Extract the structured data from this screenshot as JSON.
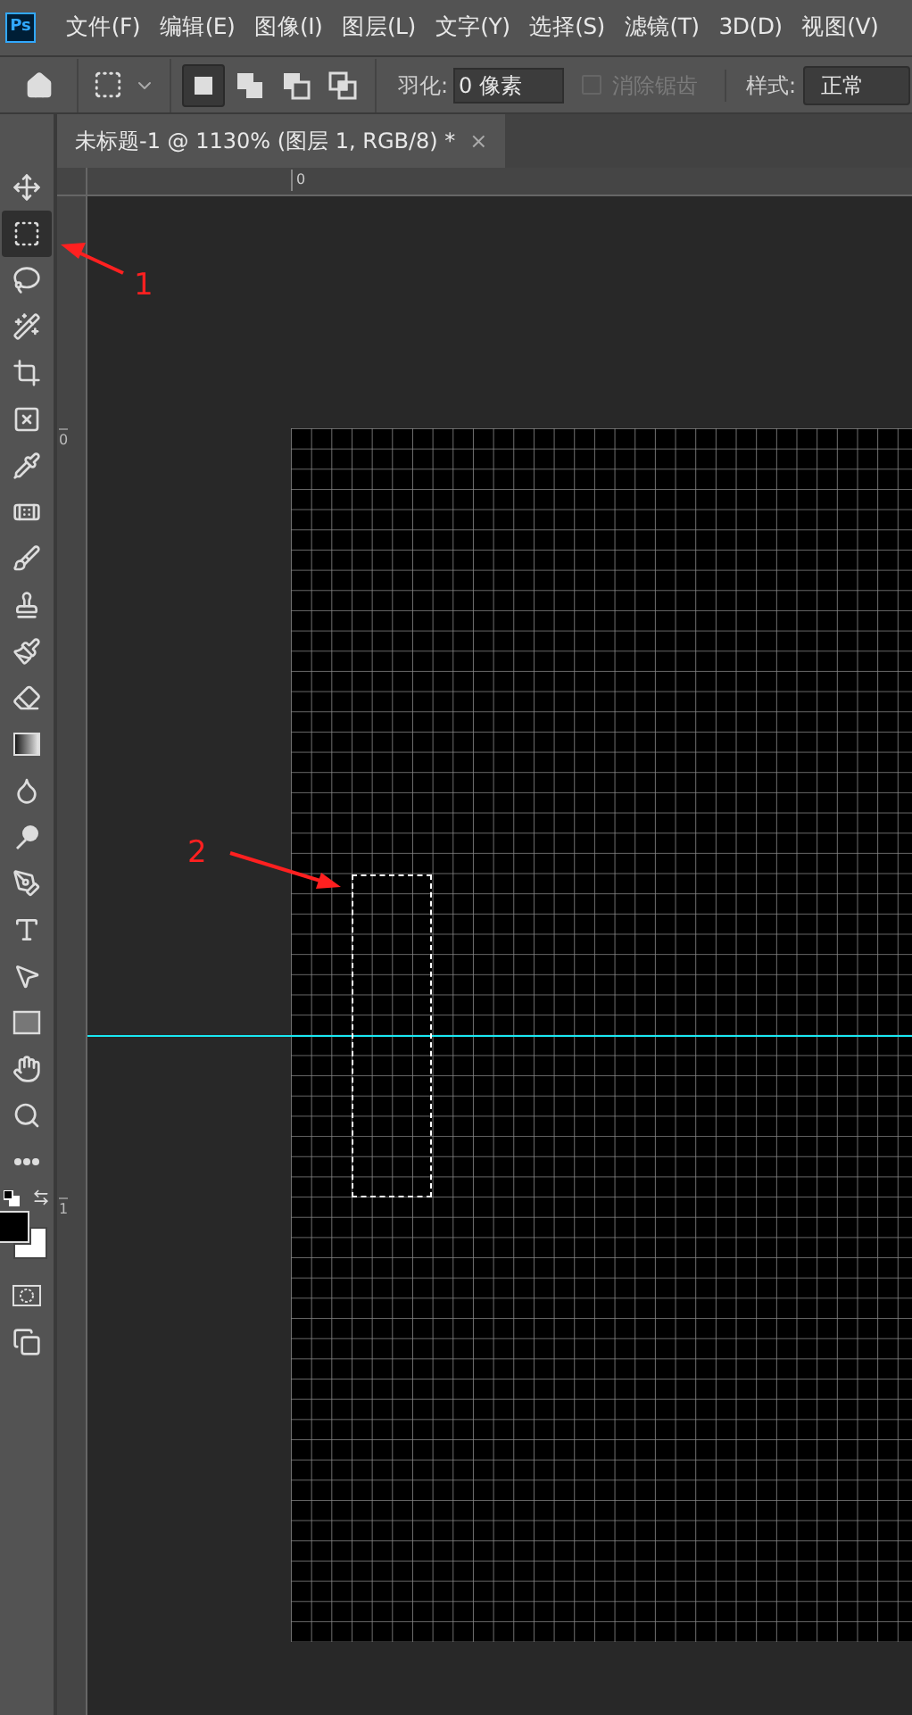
{
  "app_logo": "Ps",
  "menu": [
    "文件(F)",
    "编辑(E)",
    "图像(I)",
    "图层(L)",
    "文字(Y)",
    "选择(S)",
    "滤镜(T)",
    "3D(D)",
    "视图(V)"
  ],
  "options_bar": {
    "modes": [
      {
        "kind": "new",
        "selected": true
      },
      {
        "kind": "add",
        "selected": false
      },
      {
        "kind": "subtract",
        "selected": false
      },
      {
        "kind": "intersect",
        "selected": false
      }
    ],
    "feather_label": "羽化:",
    "feather_value": "0 像素",
    "antialias": {
      "label": "消除锯齿",
      "checked": false,
      "disabled": true
    },
    "style_label": "样式:",
    "style_value": "正常"
  },
  "document_tab": {
    "title": "未标题-1 @ 1130% (图层 1, RGB/8) *",
    "close": "×"
  },
  "rulers": {
    "horizontal": [
      "0"
    ],
    "vertical": [
      "0",
      "1"
    ]
  },
  "tools": [
    {
      "kind": "move",
      "selected": false
    },
    {
      "kind": "marquee",
      "selected": true
    },
    {
      "kind": "lasso",
      "selected": false
    },
    {
      "kind": "quick",
      "selected": false
    },
    {
      "kind": "crop",
      "selected": false
    },
    {
      "kind": "frame",
      "selected": false
    },
    {
      "kind": "eyedropper",
      "selected": false
    },
    {
      "kind": "heal",
      "selected": false
    },
    {
      "kind": "brush",
      "selected": false
    },
    {
      "kind": "stamp",
      "selected": false
    },
    {
      "kind": "history",
      "selected": false
    },
    {
      "kind": "eraser",
      "selected": false
    },
    {
      "kind": "gradient",
      "selected": false
    },
    {
      "kind": "blur",
      "selected": false
    },
    {
      "kind": "dodge",
      "selected": false
    },
    {
      "kind": "pen",
      "selected": false
    },
    {
      "kind": "type",
      "selected": false
    },
    {
      "kind": "path",
      "selected": false
    },
    {
      "kind": "rect",
      "selected": false
    },
    {
      "kind": "hand",
      "selected": false
    },
    {
      "kind": "zoom",
      "selected": false
    },
    {
      "kind": "more",
      "selected": false
    }
  ],
  "swatches": [
    {
      "kind": "foreground",
      "color": "#000000"
    },
    {
      "kind": "background",
      "color": "#ffffff"
    }
  ],
  "annotations": [
    "1",
    "2"
  ]
}
